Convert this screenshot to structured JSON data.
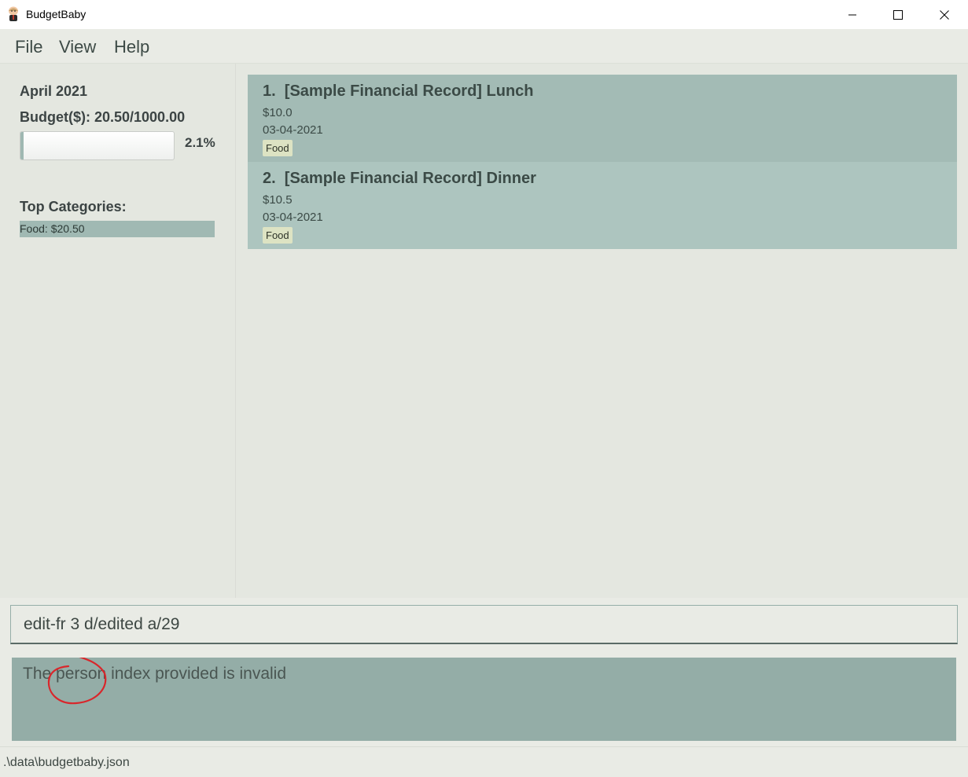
{
  "window": {
    "title": "BudgetBaby",
    "icon": "baby-app-icon"
  },
  "menu": {
    "items": [
      "File",
      "View",
      "Help"
    ]
  },
  "sidebar": {
    "month": "April 2021",
    "budget_text": "Budget($): 20.50/1000.00",
    "progress": 0.0205,
    "progress_label": "2.1%",
    "top_categories_title": "Top Categories:",
    "top_categories": [
      "Food: $20.50"
    ]
  },
  "records": [
    {
      "title": "1.  [Sample Financial Record] Lunch",
      "amount": "$10.0",
      "date": "03-04-2021",
      "tag": "Food"
    },
    {
      "title": "2.  [Sample Financial Record] Dinner",
      "amount": "$10.5",
      "date": "03-04-2021",
      "tag": "Food"
    }
  ],
  "command": {
    "value": "edit-fr 3 d/edited a/29"
  },
  "result": {
    "text": "The person index provided is invalid",
    "annotation_color": "#d9262b"
  },
  "status": {
    "path": ".\\data\\budgetbaby.json"
  },
  "colors": {
    "accent": "#94ada7",
    "card1": "#a3bbb5",
    "card2": "#adc5bf",
    "tag": "#dde3c3"
  }
}
